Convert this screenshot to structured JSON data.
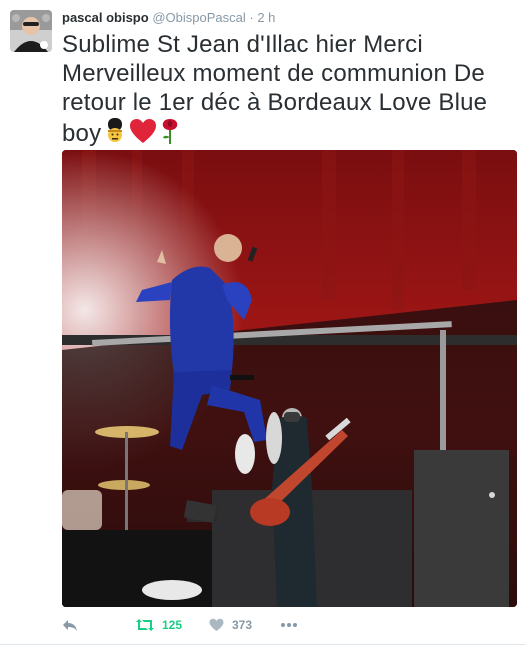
{
  "tweet": {
    "author_name": "pascal obispo",
    "handle": "@ObispoPascal",
    "separator": "·",
    "time": "2 h",
    "text": "Sublime St Jean d'Illac hier Merci Merveilleux moment de communion De retour le 1er déc à Bordeaux Love Blue boy",
    "emojis": [
      "guardsman-emoji",
      "red-heart-emoji",
      "rose-emoji"
    ]
  },
  "actions": {
    "reply_icon": "reply-icon",
    "retweet_icon": "retweet-icon",
    "retweet_count": "125",
    "like_icon": "heart-icon",
    "like_count": "373",
    "more_icon": "more-dots-icon"
  },
  "colors": {
    "retweet_active": "#19cf86",
    "muted": "#8899a6",
    "text": "#292f33"
  }
}
